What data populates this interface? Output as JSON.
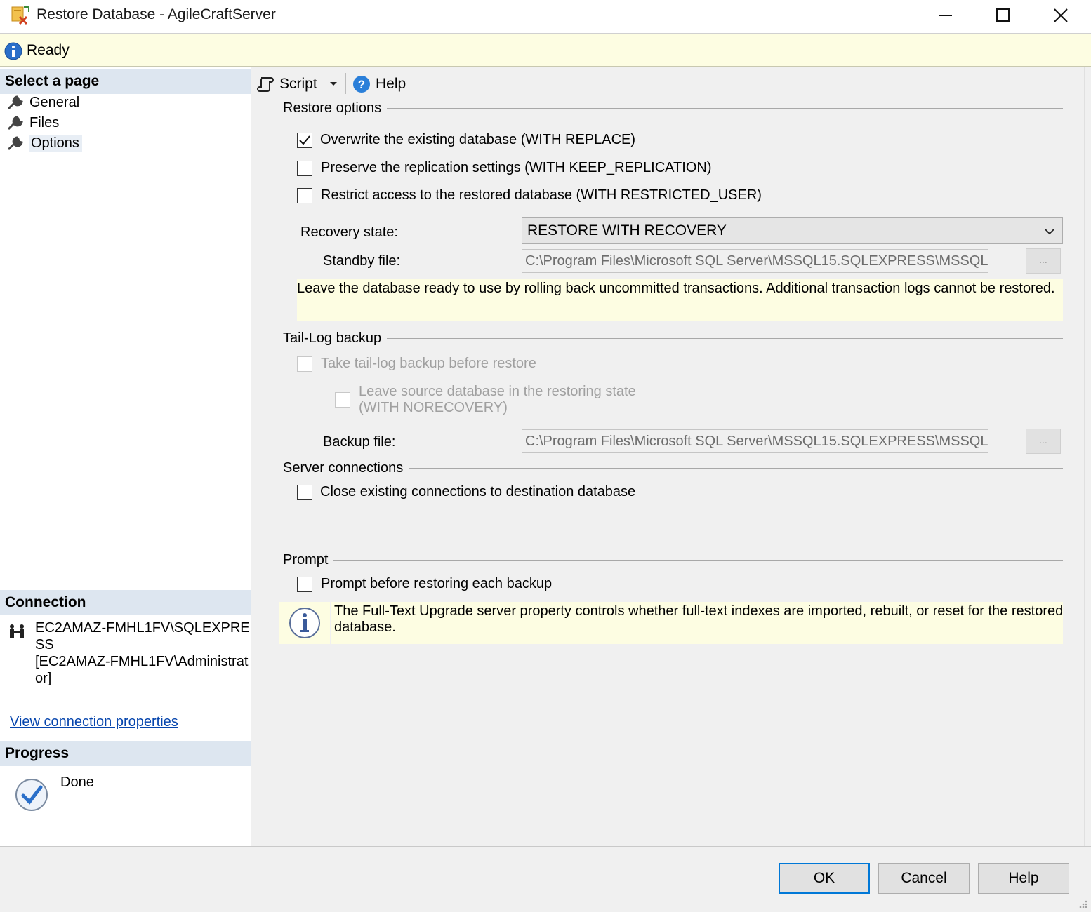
{
  "window": {
    "title": "Restore Database - AgileCraftServer"
  },
  "status": {
    "text": "Ready"
  },
  "left_panel": {
    "select_page_header": "Select a page",
    "pages": [
      {
        "label": "General",
        "selected": false
      },
      {
        "label": "Files",
        "selected": false
      },
      {
        "label": "Options",
        "selected": true
      }
    ],
    "connection_header": "Connection",
    "connection_lines": [
      "EC2AMAZ-FMHL1FV\\SQLEXPRE",
      "SS",
      "[EC2AMAZ-FMHL1FV\\Administrat",
      "or]"
    ],
    "view_connection_link": "View connection properties",
    "progress_header": "Progress",
    "progress_text": "Done"
  },
  "toolbar": {
    "script_label": "Script",
    "help_label": "Help"
  },
  "restore_options": {
    "title": "Restore options",
    "overwrite": {
      "label": "Overwrite the existing database (WITH REPLACE)",
      "checked": true
    },
    "preserve_replication": {
      "label": "Preserve the replication settings (WITH KEEP_REPLICATION)",
      "checked": false
    },
    "restrict_access": {
      "label": "Restrict access to the restored database (WITH RESTRICTED_USER)",
      "checked": false
    },
    "recovery_state_label": "Recovery state:",
    "recovery_state_value": "RESTORE WITH RECOVERY",
    "standby_file_label": "Standby file:",
    "standby_file_value": "C:\\Program Files\\Microsoft SQL Server\\MSSQL15.SQLEXPRESS\\MSSQL\\E",
    "browse_label": "...",
    "description": "Leave the database ready to use by rolling back uncommitted transactions. Additional transaction logs cannot be restored."
  },
  "tail_log": {
    "title": "Tail-Log backup",
    "take_backup": {
      "label": "Take tail-log backup before restore",
      "checked": false,
      "enabled": false
    },
    "leave_restoring_line1": "Leave source database in the restoring state",
    "leave_restoring_line2": "(WITH NORECOVERY)",
    "backup_file_label": "Backup file:",
    "backup_file_value": "C:\\Program Files\\Microsoft SQL Server\\MSSQL15.SQLEXPRESS\\MSSQL\\E",
    "browse_label": "..."
  },
  "server_connections": {
    "title": "Server connections",
    "close_connections": {
      "label": "Close existing connections to destination database",
      "checked": false
    }
  },
  "prompt": {
    "title": "Prompt",
    "prompt_before": {
      "label": "Prompt before restoring each backup",
      "checked": false
    },
    "info_line1": "The Full-Text Upgrade server property controls whether full-text indexes are imported, rebuilt, or reset for the restored",
    "info_line2": "database."
  },
  "buttons": {
    "ok": "OK",
    "cancel": "Cancel",
    "help": "Help"
  }
}
